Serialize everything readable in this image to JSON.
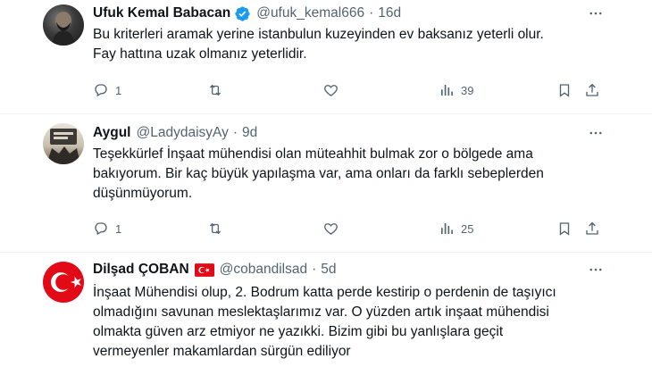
{
  "tweets": [
    {
      "name": "Ufuk Kemal Babacan",
      "handle": "@ufuk_kemal666",
      "separator": "·",
      "time": "16d",
      "text": [
        "Bu kriterleri aramak yerine istanbulun kuzeyinden ev baksanız yeterli olur.",
        "Fay hattına uzak olmanız yeterlidir."
      ],
      "replies": "1",
      "retweets": "",
      "likes": "",
      "views": "39"
    },
    {
      "name": "Aygul",
      "handle": "@LadydaisyAy",
      "separator": "·",
      "time": "9d",
      "text": [
        "Teşekkürlef İnşaat mühendisi olan müteahhit bulmak zor o bölgede ama",
        "bakıyorum. Bir kaç büyük yapılaşma var, ama onları da farklı sebeplerden",
        "düşünmüyorum."
      ],
      "replies": "1",
      "retweets": "",
      "likes": "",
      "views": "25"
    },
    {
      "name": "Dilşad ÇOBAN",
      "handle": "@cobandilsad",
      "separator": "·",
      "time": "5d",
      "text": [
        "İnşaat Mühendisi olup, 2. Bodrum katta perde kestirip o perdenin de taşıyıcı",
        "olmadığını savunan meslektaşlarımız var. O yüzden artık inşaat mühendisi",
        "olmakta güven arz etmiyor ne yazıkki. Bizim gibi bu yanlışlara geçit",
        "vermeyenler makamlardan sürgün ediliyor"
      ]
    }
  ],
  "colors": {
    "verified": "#1d9bf0",
    "flag_red": "#e30a17",
    "secondary": "#536471"
  }
}
